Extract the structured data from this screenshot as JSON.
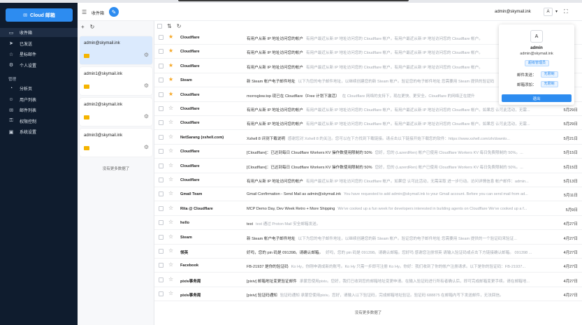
{
  "sidebar": {
    "compose_label": "Cloud 邮箱",
    "items": [
      {
        "label": "收件箱",
        "icon": "inbox-icon",
        "active": true
      },
      {
        "label": "已发送",
        "icon": "send-icon"
      },
      {
        "label": "星标邮件",
        "icon": "star-icon"
      },
      {
        "label": "个人设置",
        "icon": "gear-icon"
      }
    ],
    "group_label": "管理",
    "admin_items": [
      {
        "label": "分析页",
        "icon": "chart-icon"
      },
      {
        "label": "用户列表",
        "icon": "user-icon"
      },
      {
        "label": "邮件列表",
        "icon": "mail-list-icon"
      },
      {
        "label": "权限控制",
        "icon": "key-icon"
      },
      {
        "label": "系统设置",
        "icon": "settings-icon"
      }
    ]
  },
  "accounts": {
    "title": "收件箱",
    "list": [
      {
        "email": "admin@skymail.ink",
        "active": true
      },
      {
        "email": "admin1@skymail.ink"
      },
      {
        "email": "admin2@skymail.ink"
      },
      {
        "email": "admin3@skymail.ink"
      }
    ],
    "no_more": "没有更多数据了"
  },
  "header": {
    "user_email": "admin@skymail.ink",
    "avatar_letter": "A"
  },
  "popup": {
    "avatar_letter": "A",
    "name": "admin",
    "email": "admin@skymail.ink",
    "role": "超级管理员",
    "send_label": "邮件发送：",
    "send_value": "无限制",
    "add_label": "邮箱添加：",
    "add_value": "无限制",
    "logout_label": "退出"
  },
  "emails": [
    {
      "sender": "Cloudflare",
      "starred": true,
      "subject": "有用户从新 IP 地址访问您的帐户",
      "preview": "有用户最近从新 IP 地址访问您的 Cloudflare 帐户。有用户最近从新 IP 地址访问您的 Cloudflare 帐户。",
      "date": ""
    },
    {
      "sender": "Cloudflare",
      "starred": true,
      "subject": "有用户从新 IP 地址访问您的帐户",
      "preview": "有用户最近从新 IP 地址访问您的 Cloudflare 帐户。有用户最近从新 IP 地址访问您的 Cloudflare 帐户。",
      "date": ""
    },
    {
      "sender": "Cloudflare",
      "starred": true,
      "subject": "有用户从新 IP 地址访问您的帐户",
      "preview": "有用户最近从新 IP 地址访问您的 Cloudflare 帐户。有用户最近从新 IP 地址访问您的 Cloudflare 帐户。",
      "date": ""
    },
    {
      "sender": "Steam",
      "starred": true,
      "subject": "新 Steam 帐户电子邮件地址",
      "preview": "以下为您的电子邮件地址，以继续创建您的新 Steam 帐户。验证您的电子邮件地址 您需要用 Steam 提供的验证码",
      "date": ""
    },
    {
      "sender": "Cloudflare",
      "starred": true,
      "subject": "morroglow.top 现已在 Cloudflare（Free 计划下激活）",
      "preview": "在 Cloudflare 网络的支持下，现在更快、更安全。Cloudflare 的网络正在提升",
      "date": ""
    },
    {
      "sender": "Cloudflare",
      "starred": false,
      "subject": "有用户从新 IP 地址访问您的帐户",
      "preview": "有用户最近从新 IP 地址访问您的 Cloudflare 帐户。有用户最近从新 IP 地址访问您的 Cloudflare 帐户。如果您 认可此活动，无需...",
      "date": "5月29日"
    },
    {
      "sender": "Cloudflare",
      "starred": false,
      "subject": "有用户从新 IP 地址访问您的帐户",
      "preview": "有用户最近从新 IP 地址访问您的 Cloudflare 帐户。有用户最近从新 IP 地址访问您的 Cloudflare 帐户。如果您 认可此活动，无需...",
      "date": "5月29日"
    },
    {
      "sender": "NetSarang (xshell.com)",
      "starred": false,
      "subject": "Xshell 8 评测下载说明",
      "preview": "感谢您对 Xshell 8 的关注。您可以在下方找到下载链接。请点击以下链接开始下载您的软件：https://www.xshell.com/zh/downlo...",
      "date": "5月21日"
    },
    {
      "sender": "Cloudflare",
      "starred": false,
      "subject": "[Cloudflare]：已达到每日 Cloudflare Workers KV 操作数使用限制的 50%",
      "preview": "您好，您的 (LazerdRen) 帐户已使用 Cloudflare Workers KV 每日免费限制的 50%。...",
      "date": "5月15日"
    },
    {
      "sender": "Cloudflare",
      "starred": false,
      "subject": "[Cloudflare]：已达到每日 Cloudflare Workers KV 操作数使用限制的 50%",
      "preview": "您好，您的 (LazerdRen) 帐户已使用 Cloudflare Workers KV 每日免费限制的 50%。...",
      "date": "5月15日"
    },
    {
      "sender": "Cloudflare",
      "starred": false,
      "subject": "有用户从新 IP 地址访问您的帐户",
      "preview": "有用户最近从新 IP 地址访问您的 Cloudflare 帐户。如果您 认可此活动，无需采取 进一步行动。访问详情信息 帐户邮件：admin...",
      "date": "5月13日"
    },
    {
      "sender": "Gmail Team",
      "starred": false,
      "subject": "Gmail Confirmation - Send Mail as admin@skymail.ink",
      "preview": "You have requested to add admin@skymail.ink to your Gmail account. Before you can send mail from ad...",
      "date": "5月11日"
    },
    {
      "sender": "Rita @ Cloudflare",
      "starred": false,
      "subject": "MCP Demo Day, Dev Week Retro + More Shipping",
      "preview": "We've cooked up a fun week for developers interested in building agents on Cloudflare We've cooked up a f...",
      "date": "5月9日"
    },
    {
      "sender": "hello",
      "starred": false,
      "subject": "test",
      "preview": "test 通过 Proton Mail 安全邮箱发送。",
      "date": "4月27日"
    },
    {
      "sender": "Steam",
      "starred": false,
      "subject": "新 Steam 帐户电子邮件地址",
      "preview": "以下为您的电子邮件地址，以继续创建您的新 Steam 帐户。验证您的电子邮件地址 您需要用 Steam 提供的一个验证码来验证...",
      "date": "4月27日"
    },
    {
      "sender": "领英",
      "starred": false,
      "subject": "好吗，您的 pin 码是 091398。请确认邮箱。",
      "preview": "好吗，您的 pin 码是 091398。请确认邮箱。您好吗 感谢您注册领英 请输入验证码或点击下方链接确认邮箱。 091398 ...",
      "date": "4月27日"
    },
    {
      "sender": "Facebook",
      "starred": false,
      "subject": "FB-21937 是你的验证码",
      "preview": "Ko Hy，你刚申请成新的账号。Ko Hy 只需一步即可注册 Ko Hy。你好：我们收到了你的帐户注册请求。以下是你的验证码：FB-21937...",
      "date": "4月27日"
    },
    {
      "sender": "pixiv事务局",
      "starred": false,
      "subject": "[pixiv] 邮箱地址变更验证邮件",
      "preview": "承蒙您使用pixiv。您好，我们已收到您的邮箱地址变更申请。在输入验证码进行所有者确认后，即可完成邮箱变更手续。请在邮箱地...",
      "date": "4月27日"
    },
    {
      "sender": "pixiv事务局",
      "starred": false,
      "subject": "[pixiv] 验证码通知",
      "preview": "验证码通知 承蒙您使用pixiv。您好，请输入以下验证码，完成邮箱地址验证。验证码 688875 在邮箱内写下发送邮件，无法回信。",
      "date": "4月27日"
    }
  ],
  "main_no_more": "没有更多数据了",
  "colors": {
    "sidebar": "#0f1c2e",
    "accent": "#2d8cf0",
    "star": "#f5a623",
    "env": "#f5b400"
  }
}
